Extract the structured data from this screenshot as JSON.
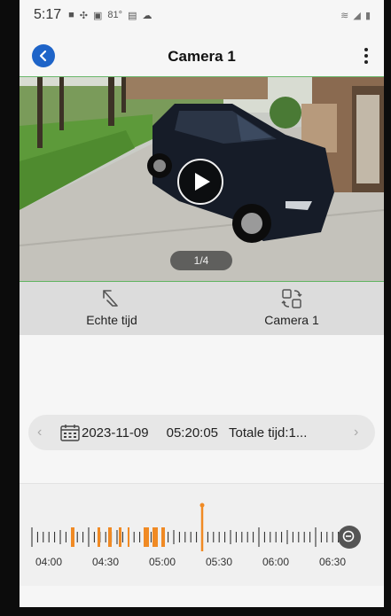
{
  "status_bar": {
    "time": "5:17",
    "left_icons": [
      "message-icon",
      "grid-icon",
      "image-icon",
      "temperature-icon",
      "doc-icon",
      "cloud-icon"
    ],
    "temperature": "81°",
    "right_icons": [
      "wifi-icon",
      "signal-icon",
      "battery-icon"
    ]
  },
  "header": {
    "title": "Camera 1"
  },
  "video": {
    "page_indicator": "1/4"
  },
  "controls": {
    "live_label": "Echte tijd",
    "camera_label": "Camera 1"
  },
  "date_bar": {
    "date": "2023-11-09",
    "time": "05:20:05",
    "total": "Totale tijd:1..."
  },
  "timeline": {
    "labels": [
      "04:00",
      "04:30",
      "05:00",
      "05:30",
      "06:00",
      "06:30"
    ],
    "cursor_time": "05:20",
    "accent_color": "#f08a24"
  }
}
